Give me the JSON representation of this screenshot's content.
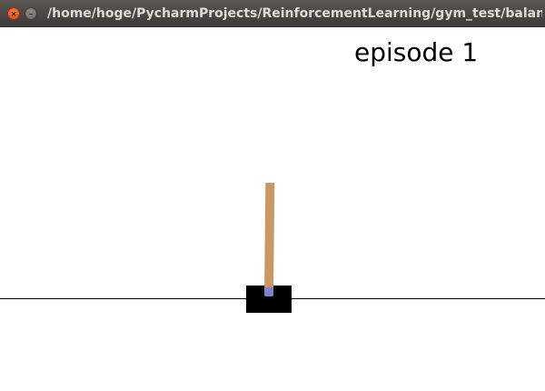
{
  "window": {
    "title": "/home/hoge/PycharmProjects/ReinforcementLearning/gym_test/balance_",
    "close_glyph": "×",
    "minimize_glyph": "–"
  },
  "scene": {
    "episode_label": "episode 1",
    "colors": {
      "pole": "#ca9865",
      "cart": "#000000",
      "axle": "#8184cb",
      "track": "#000000",
      "background": "#ffffff"
    }
  }
}
